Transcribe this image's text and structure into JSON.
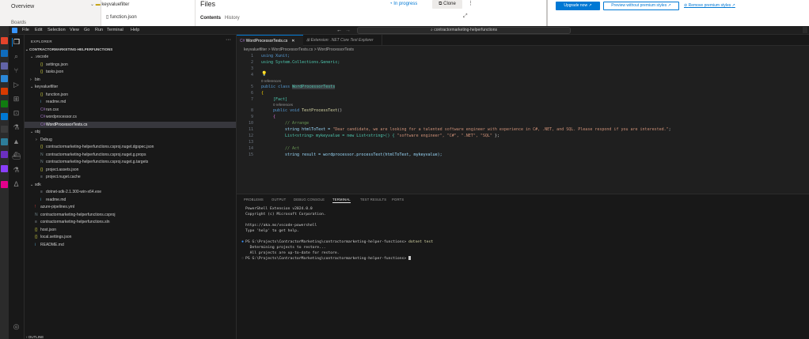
{
  "web": {
    "nav_overview": "Overview",
    "nav_boards": "Boards",
    "tree_folder": "keyvaluefilter",
    "tree_file": "function.json",
    "files_title": "Files",
    "tab_contents": "Contents",
    "tab_history": "History",
    "status": "In progress",
    "clone_label": "Clone",
    "upgrade_label": "Upgrade now",
    "preview_label": "Preview without premium styles",
    "remove_label": "Remove premium styles"
  },
  "vscode": {
    "menu": [
      "File",
      "Edit",
      "Selection",
      "View",
      "Go",
      "Run",
      "Terminal",
      "Help"
    ],
    "search": "contractormarketing-helperfunctions",
    "explorer_title": "EXPLORER",
    "workspace": "CONTRACTORMARKETING-HELPERFUNCTIONS",
    "outline": "OUTLINE",
    "tree": [
      {
        "indent": 1,
        "chevron": "v",
        "icon": "",
        "label": ".vscode",
        "color": "#cccccc"
      },
      {
        "indent": 2,
        "chevron": "",
        "icon": "{}",
        "label": "settings.json",
        "color": "#cccccc"
      },
      {
        "indent": 2,
        "chevron": "",
        "icon": "{}",
        "label": "tasks.json",
        "color": "#cccccc"
      },
      {
        "indent": 1,
        "chevron": ">",
        "icon": "",
        "label": "bin",
        "color": "#cccccc"
      },
      {
        "indent": 1,
        "chevron": "v",
        "icon": "",
        "label": "keyvaluefilter",
        "color": "#cccccc"
      },
      {
        "indent": 2,
        "chevron": "",
        "icon": "{}",
        "label": "function.json",
        "color": "#cccccc"
      },
      {
        "indent": 2,
        "chevron": "",
        "icon": "i",
        "label": "readme.md",
        "color": "#cccccc"
      },
      {
        "indent": 2,
        "chevron": "",
        "icon": "C#",
        "label": "run.csx",
        "color": "#cccccc"
      },
      {
        "indent": 2,
        "chevron": "",
        "icon": "C#",
        "label": "wordprocessor.cs",
        "color": "#cccccc"
      },
      {
        "indent": 2,
        "chevron": "",
        "icon": "C#",
        "label": "WordProcessorTests.cs",
        "color": "#ffffff",
        "selected": true
      },
      {
        "indent": 1,
        "chevron": "v",
        "icon": "",
        "label": "obj",
        "color": "#cccccc"
      },
      {
        "indent": 2,
        "chevron": ">",
        "icon": "",
        "label": "Debug",
        "color": "#cccccc"
      },
      {
        "indent": 2,
        "chevron": "",
        "icon": "{}",
        "label": "contractormarketing-helperfunctions.csproj.nuget.dgspec.json",
        "color": "#cccccc"
      },
      {
        "indent": 2,
        "chevron": "",
        "icon": "N",
        "label": "contractormarketing-helperfunctions.csproj.nuget.g.props",
        "color": "#cccccc"
      },
      {
        "indent": 2,
        "chevron": "",
        "icon": "N",
        "label": "contractormarketing-helperfunctions.csproj.nuget.g.targets",
        "color": "#cccccc"
      },
      {
        "indent": 2,
        "chevron": "",
        "icon": "{}",
        "label": "project.assets.json",
        "color": "#cccccc"
      },
      {
        "indent": 2,
        "chevron": "",
        "icon": "≡",
        "label": "project.nuget.cache",
        "color": "#cccccc"
      },
      {
        "indent": 1,
        "chevron": "v",
        "icon": "",
        "label": "sdk",
        "color": "#cccccc"
      },
      {
        "indent": 2,
        "chevron": "",
        "icon": "≡",
        "label": "dotnet-sdk-2.1.300-win-x64.exe",
        "color": "#cccccc"
      },
      {
        "indent": 2,
        "chevron": "",
        "icon": "i",
        "label": "readme.md",
        "color": "#cccccc"
      },
      {
        "indent": 1,
        "chevron": "",
        "icon": "!",
        "label": "azure-pipelines.yml",
        "color": "#cccccc"
      },
      {
        "indent": 1,
        "chevron": "",
        "icon": "N",
        "label": "contractormarketing-helperfunctions.csproj",
        "color": "#cccccc"
      },
      {
        "indent": 1,
        "chevron": "",
        "icon": "≡",
        "label": "contractormarketing-helperfunctions.sln",
        "color": "#cccccc"
      },
      {
        "indent": 1,
        "chevron": "",
        "icon": "{}",
        "label": "host.json",
        "color": "#cccccc"
      },
      {
        "indent": 1,
        "chevron": "",
        "icon": "{}",
        "label": "local.settings.json",
        "color": "#cccccc"
      },
      {
        "indent": 1,
        "chevron": "",
        "icon": "i",
        "label": "README.md",
        "color": "#cccccc"
      }
    ],
    "tab_active": "WordProcessorTests.cs",
    "tab_inactive": "Extension: .NET Core Test Explorer",
    "breadcrumb": "keyvaluefilter > WordProcessorTests.cs > WordProcessorTests",
    "codelens_refs": "0 references",
    "code": {
      "l1": "using Xunit;",
      "l2": "using System.Collections.Generic;",
      "l5_a": "public class ",
      "l5_b": "WordProcessorTests",
      "l6": "{",
      "l7": "[Fact]",
      "l8_a": "public void ",
      "l8_b": "TestProcessText",
      "l8_c": "()",
      "l9": "{",
      "l10": "// Arrange",
      "l11_a": "string htmlToText = ",
      "l11_b": "\"Dear candidate, we are looking for a talented software engineer with experience in C#, .NET, and SQL. Please respond if you are interested.\"",
      "l11_c": ";",
      "l12_a": "List<string> mykeyvalue = new List<string>() { ",
      "l12_b": "\"software engineer\", \"C#\", \".NET\", \"SQL\"",
      "l12_c": " };",
      "l14": "// Act",
      "l15": "string result = wordprocessor.processText(htmlToText, mykeyvalue);"
    },
    "panel_tabs": [
      "PROBLEMS",
      "OUTPUT",
      "DEBUG CONSOLE",
      "TERMINAL",
      "TEST RESULTS",
      "PORTS"
    ],
    "terminal": {
      "t1": "PowerShell Extension v2024.0.0",
      "t2": "Copyright (c) Microsoft Corporation.",
      "t3": "https://aka.ms/vscode-powershell",
      "t4": "Type 'help' to get help.",
      "t5_a": "PS G:\\Projects\\ContractorMarketing\\contractormarketing-helper-functions> ",
      "t5_b": "dotnet test",
      "t6": "  Determining projects to restore...",
      "t7": "  All projects are up-to-date for restore.",
      "t8": "PS G:\\Projects\\ContractorMarketing\\contractormarketing-helper-functions> "
    }
  },
  "colors": {
    "accent": "#0078d4",
    "background": "#1f1f1f"
  }
}
